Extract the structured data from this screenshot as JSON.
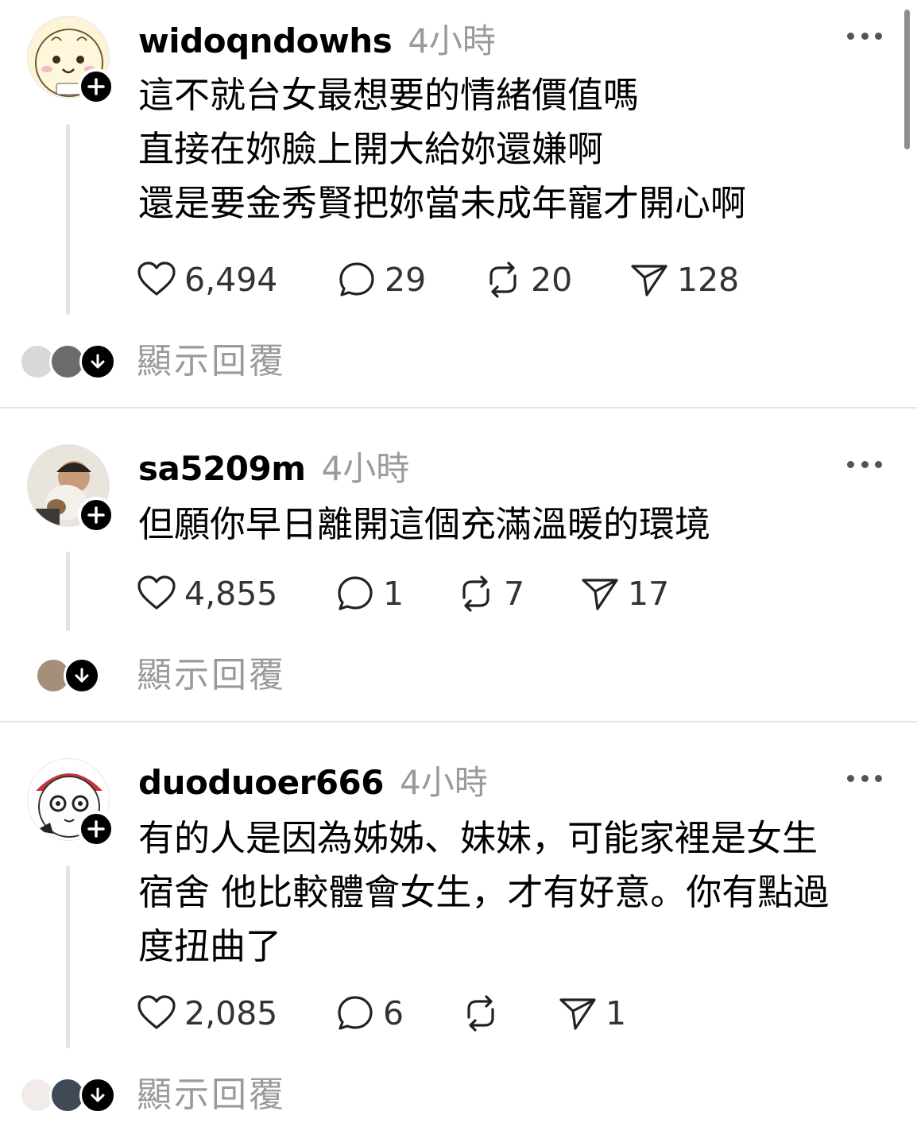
{
  "posts": [
    {
      "username": "widoqndowhs",
      "time_ago": "4小時",
      "lines": [
        "這不就台女最想要的情緒價值嗎",
        "直接在妳臉上開大給妳還嫌啊",
        "還是要金秀賢把妳當未成年寵才開心啊"
      ],
      "likes": "6,494",
      "comments": "29",
      "reposts": "20",
      "shares": "128",
      "show_replies": "顯示回覆"
    },
    {
      "username": "sa5209m",
      "time_ago": "4小時",
      "lines": [
        "但願你早日離開這個充滿溫暖的環境"
      ],
      "likes": "4,855",
      "comments": "1",
      "reposts": "7",
      "shares": "17",
      "show_replies": "顯示回覆"
    },
    {
      "username": "duoduoer666",
      "time_ago": "4小時",
      "lines": [
        "有的人是因為姊姊、妹妹，可能家裡是女生",
        "宿舍 他比較體會女生，才有好意。你有點過",
        "度扭曲了"
      ],
      "likes": "2,085",
      "comments": "6",
      "reposts": "",
      "shares": "1",
      "show_replies": "顯示回覆"
    }
  ],
  "icons": {
    "like": "heart-icon",
    "comment": "speech-bubble-icon",
    "repost": "repost-arrows-icon",
    "share": "paper-plane-icon",
    "more": "more-dots-icon",
    "follow": "plus-icon",
    "expand": "arrow-down-icon"
  },
  "colors": {
    "text": "#000000",
    "muted": "#9a9a9a",
    "divider": "#e3e3e3"
  }
}
